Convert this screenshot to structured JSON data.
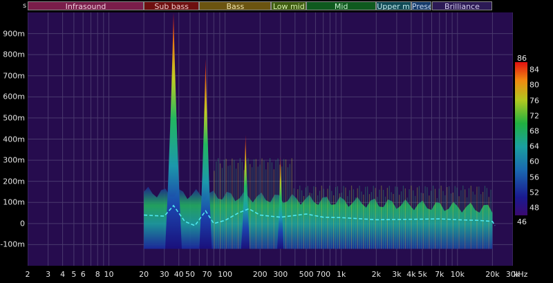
{
  "bands": [
    {
      "label": "Infrasound",
      "color": "#7a1d4a",
      "text": "#f0d0e0",
      "f0": 2,
      "f1": 20
    },
    {
      "label": "Sub bass",
      "color": "#6e0f0f",
      "text": "#f0d0d0",
      "f0": 20,
      "f1": 60
    },
    {
      "label": "Bass",
      "color": "#6b5410",
      "text": "#f0e6b0",
      "f0": 60,
      "f1": 250
    },
    {
      "label": "Low mid",
      "color": "#3f5d10",
      "text": "#d8f0b0",
      "f0": 250,
      "f1": 500
    },
    {
      "label": "Mid",
      "color": "#0f5a1e",
      "text": "#c8f0d0",
      "f0": 500,
      "f1": 2000
    },
    {
      "label": "Upper mi",
      "color": "#104a55",
      "text": "#c8eef0",
      "f0": 2000,
      "f1": 4000
    },
    {
      "label": "Prese",
      "color": "#143a6a",
      "text": "#c8d8f0",
      "f0": 4000,
      "f1": 6000
    },
    {
      "label": "Brilliance",
      "color": "#2c1a55",
      "text": "#d8d0f0",
      "f0": 6000,
      "f1": 20000
    }
  ],
  "y_unit": "s",
  "x_unit": "kHz",
  "chart_data": {
    "type": "heatmap",
    "title": "",
    "xscale": "log",
    "xlim": [
      2,
      30000
    ],
    "ylim": [
      -200,
      1000
    ],
    "x_ticks": [
      {
        "v": 2,
        "l": "2"
      },
      {
        "v": 3,
        "l": "3"
      },
      {
        "v": 4,
        "l": "4"
      },
      {
        "v": 5,
        "l": "5"
      },
      {
        "v": 6,
        "l": "6"
      },
      {
        "v": 8,
        "l": "8"
      },
      {
        "v": 10,
        "l": "10"
      },
      {
        "v": 20,
        "l": "20"
      },
      {
        "v": 30,
        "l": "30"
      },
      {
        "v": 40,
        "l": "40"
      },
      {
        "v": 50,
        "l": "50"
      },
      {
        "v": 70,
        "l": "70"
      },
      {
        "v": 100,
        "l": "100"
      },
      {
        "v": 200,
        "l": "200"
      },
      {
        "v": 300,
        "l": "300"
      },
      {
        "v": 500,
        "l": "500"
      },
      {
        "v": 700,
        "l": "700"
      },
      {
        "v": 1000,
        "l": "1k"
      },
      {
        "v": 2000,
        "l": "2k"
      },
      {
        "v": 3000,
        "l": "3k"
      },
      {
        "v": 4000,
        "l": "4k"
      },
      {
        "v": 5000,
        "l": "5k"
      },
      {
        "v": 7000,
        "l": "7k"
      },
      {
        "v": 10000,
        "l": "10k"
      },
      {
        "v": 20000,
        "l": "20k"
      },
      {
        "v": 30000,
        "l": "30k"
      }
    ],
    "y_ticks": [
      {
        "v": 900,
        "l": "900m"
      },
      {
        "v": 800,
        "l": "800m"
      },
      {
        "v": 700,
        "l": "700m"
      },
      {
        "v": 600,
        "l": "600m"
      },
      {
        "v": 500,
        "l": "500m"
      },
      {
        "v": 400,
        "l": "400m"
      },
      {
        "v": 300,
        "l": "300m"
      },
      {
        "v": 200,
        "l": "200m"
      },
      {
        "v": 100,
        "l": "100m"
      },
      {
        "v": 0,
        "l": "0"
      },
      {
        "v": -100,
        "l": "-100m"
      }
    ],
    "colorbar": {
      "min": 46,
      "max": 86,
      "ticks": [
        84,
        80,
        76,
        72,
        68,
        64,
        60,
        56,
        52,
        48
      ],
      "min_label": "46",
      "max_label": "86"
    },
    "peaks": [
      {
        "f": 36,
        "top": 1000,
        "w": 4
      },
      {
        "f": 68,
        "top": 780,
        "w": 3
      },
      {
        "f": 150,
        "top": 420,
        "w": 2
      },
      {
        "f": 300,
        "top": 320,
        "w": 1.5
      }
    ],
    "spectrum_extent": {
      "f0": 20,
      "f1": 20000,
      "top_low": 150,
      "top_high": 70,
      "bottom": -120
    },
    "trace": [
      [
        20,
        40
      ],
      [
        30,
        35
      ],
      [
        36,
        85
      ],
      [
        45,
        10
      ],
      [
        55,
        -10
      ],
      [
        68,
        60
      ],
      [
        80,
        0
      ],
      [
        100,
        15
      ],
      [
        130,
        50
      ],
      [
        160,
        70
      ],
      [
        200,
        40
      ],
      [
        300,
        30
      ],
      [
        500,
        45
      ],
      [
        700,
        30
      ],
      [
        1000,
        28
      ],
      [
        2000,
        18
      ],
      [
        4000,
        20
      ],
      [
        7000,
        22
      ],
      [
        10000,
        18
      ],
      [
        15000,
        15
      ],
      [
        20000,
        10
      ],
      [
        21000,
        -10
      ]
    ],
    "grid": true
  }
}
